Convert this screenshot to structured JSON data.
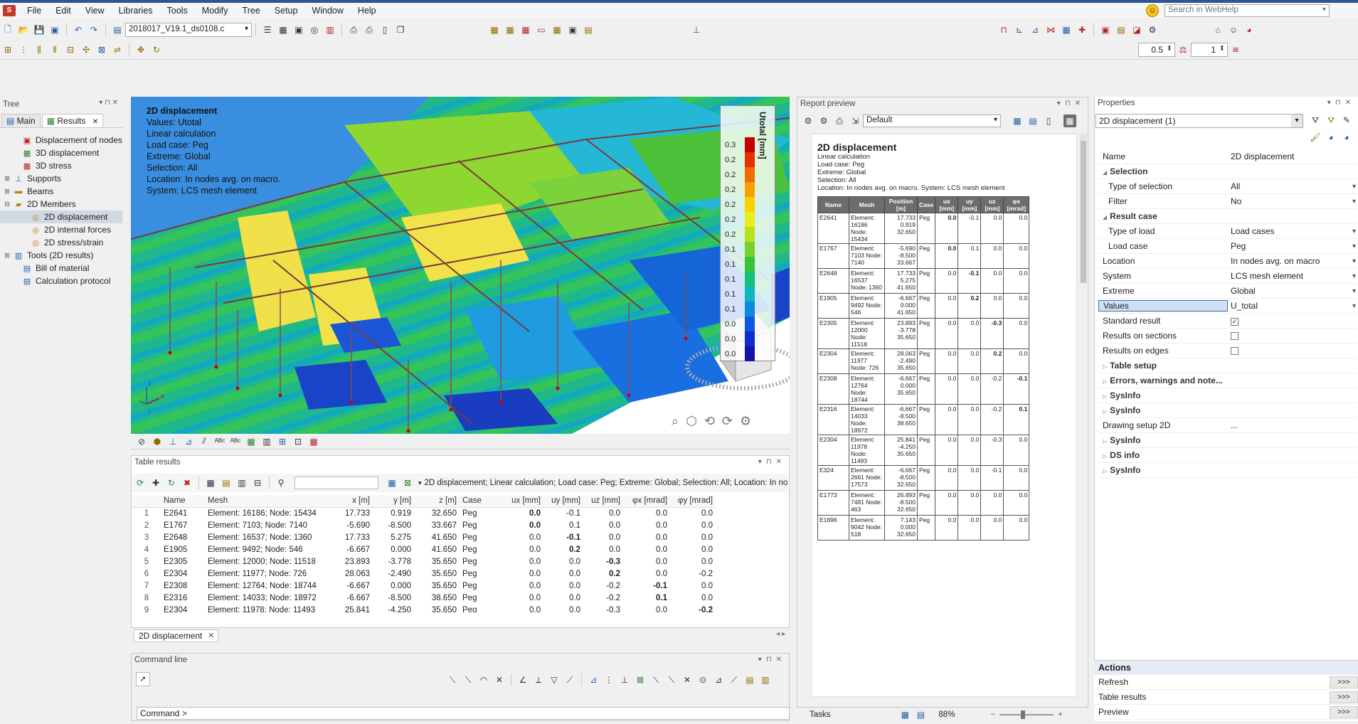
{
  "menu": [
    "File",
    "Edit",
    "View",
    "Libraries",
    "Tools",
    "Modify",
    "Tree",
    "Setup",
    "Window",
    "Help"
  ],
  "search": {
    "placeholder": "Search in WebHelp"
  },
  "toolbar": {
    "file_name": "2018017_V19.1_ds0108.c",
    "spin1": "0.5",
    "spin2": "1"
  },
  "tree": {
    "title": "Tree",
    "tabs": [
      "Main",
      "Results"
    ],
    "items": [
      {
        "label": "Displacement of nodes",
        "icon": "node-displacement-icon"
      },
      {
        "label": "3D displacement",
        "icon": "3d-displacement-icon"
      },
      {
        "label": "3D stress",
        "icon": "3d-stress-icon"
      },
      {
        "label": "Supports",
        "icon": "supports-icon"
      },
      {
        "label": "Beams",
        "icon": "beams-icon"
      },
      {
        "label": "2D Members",
        "icon": "2d-members-icon"
      },
      {
        "label": "2D displacement",
        "icon": "2d-displacement-icon"
      },
      {
        "label": "2D internal forces",
        "icon": "2d-forces-icon"
      },
      {
        "label": "2D stress/strain",
        "icon": "2d-stress-icon"
      },
      {
        "label": "Tools (2D results)",
        "icon": "tools-icon"
      },
      {
        "label": "Bill of material",
        "icon": "bill-icon"
      },
      {
        "label": "Calculation protocol",
        "icon": "protocol-icon"
      }
    ]
  },
  "viewport": {
    "title": "2D displacement",
    "lines": [
      "Values: Utotal",
      "Linear calculation",
      "Load case: Peg",
      "Extreme: Global",
      "Selection: All",
      "Location: In nodes avg. on macro.",
      "System: LCS mesh element"
    ],
    "legend_title": "Utotal [mm]",
    "legend_values": [
      "0.3",
      "0.2",
      "0.2",
      "0.2",
      "0.2",
      "0.2",
      "0.2",
      "0.1",
      "0.1",
      "0.1",
      "0.1",
      "0.1",
      "0.0",
      "0.0",
      "0.0"
    ],
    "legend_colors": [
      "#c40000",
      "#e53000",
      "#f06a00",
      "#f7a000",
      "#f7d300",
      "#e7ee1c",
      "#b8e21c",
      "#78d22a",
      "#38c238",
      "#14bf7a",
      "#0cb8c0",
      "#0c8ae0",
      "#0c58e0",
      "#0c2ed0",
      "#1414a8"
    ]
  },
  "table": {
    "title": "Table results",
    "description": "2D displacement; Linear calculation; Load case: Peg; Extreme: Global; Selection: All; Location: In nodes avg",
    "columns": [
      "",
      "Name",
      "Mesh",
      "x [m]",
      "y [m]",
      "z [m]",
      "Case",
      "ux [mm]",
      "uy [mm]",
      "uz [mm]",
      "φx [mrad]",
      "φy [mrad]"
    ],
    "rows": [
      [
        "1",
        "E2641",
        "Element: 16186; Node: 15434",
        "17.733",
        "0.919",
        "32.650",
        "Peg",
        "0.0",
        "-0.1",
        "0.0",
        "0.0",
        "0.0"
      ],
      [
        "2",
        "E1767",
        "Element: 7103; Node: 7140",
        "-5.690",
        "-8.500",
        "33.667",
        "Peg",
        "0.0",
        "0.1",
        "0.0",
        "0.0",
        "0.0"
      ],
      [
        "3",
        "E2648",
        "Element: 16537; Node: 1360",
        "17.733",
        "5.275",
        "41.650",
        "Peg",
        "0.0",
        "-0.1",
        "0.0",
        "0.0",
        "0.0"
      ],
      [
        "4",
        "E1905",
        "Element: 9492; Node: 546",
        "-6.667",
        "0.000",
        "41.650",
        "Peg",
        "0.0",
        "0.2",
        "0.0",
        "0.0",
        "0.0"
      ],
      [
        "5",
        "E2305",
        "Element: 12000; Node: 11518",
        "23.893",
        "-3.778",
        "35.650",
        "Peg",
        "0.0",
        "0.0",
        "-0.3",
        "0.0",
        "0.0"
      ],
      [
        "6",
        "E2304",
        "Element: 11977; Node: 726",
        "28.063",
        "-2.490",
        "35.650",
        "Peg",
        "0.0",
        "0.0",
        "0.2",
        "0.0",
        "-0.2"
      ],
      [
        "7",
        "E2308",
        "Element: 12764; Node: 18744",
        "-6.667",
        "0.000",
        "35.650",
        "Peg",
        "0.0",
        "0.0",
        "-0.2",
        "-0.1",
        "0.0"
      ],
      [
        "8",
        "E2316",
        "Element: 14033; Node: 18972",
        "-6.667",
        "-8.500",
        "38.650",
        "Peg",
        "0.0",
        "0.0",
        "-0.2",
        "0.1",
        "0.0"
      ],
      [
        "9",
        "E2304",
        "Element: 11978; Node: 11493",
        "25.841",
        "-4.250",
        "35.650",
        "Peg",
        "0.0",
        "0.0",
        "-0.3",
        "0.0",
        "-0.2"
      ]
    ],
    "tab_label": "2D displacement"
  },
  "command": {
    "title": "Command line",
    "prompt": "Command >"
  },
  "report": {
    "title": "Report preview",
    "combo": "Default",
    "page_title": "2D displacement",
    "meta": [
      "Linear calculation",
      "Load case: Peg",
      "Extreme: Global",
      "Selection: All",
      "Location: In nodes avg. on macro. System: LCS mesh element"
    ],
    "columns": [
      "Name",
      "Mesh",
      "Position [m]",
      "Case",
      "ux [mm]",
      "uy [mm]",
      "uz [mm]",
      "φx [mrad]"
    ],
    "rows": [
      [
        "E2641",
        "Element: 16186 Node: 15434",
        "17.733 0.919 32.650",
        "Peg",
        "0.0",
        "-0.1",
        "0.0",
        "0.0"
      ],
      [
        "E1767",
        "Element: 7103 Node: 7140",
        "-5.690 -8.500 33.667",
        "Peg",
        "0.0",
        "0.1",
        "0.0",
        "0.0"
      ],
      [
        "E2648",
        "Element: 16537 Node: 1360",
        "17.733 5.275 41.650",
        "Peg",
        "0.0",
        "-0.1",
        "0.0",
        "0.0"
      ],
      [
        "E1905",
        "Element: 9492 Node: 546",
        "-6.667 0.000 41.650",
        "Peg",
        "0.0",
        "0.2",
        "0.0",
        "0.0"
      ],
      [
        "E2305",
        "Element: 12000 Node: 11518",
        "23.893 -3.778 35.650",
        "Peg",
        "0.0",
        "0.0",
        "-0.3",
        "0.0"
      ],
      [
        "E2304",
        "Element: 11977 Node: 726",
        "28.063 -2.490 35.650",
        "Peg",
        "0.0",
        "0.0",
        "0.2",
        "0.0"
      ],
      [
        "E2308",
        "Element: 12764 Node: 18744",
        "-6.667 0.000 35.650",
        "Peg",
        "0.0",
        "0.0",
        "-0.2",
        "-0.1"
      ],
      [
        "E2316",
        "Element: 14033 Node: 18972",
        "-6.667 -8.500 38.650",
        "Peg",
        "0.0",
        "0.0",
        "-0.2",
        "0.1"
      ],
      [
        "E2304",
        "Element: 11978 Node: 11493",
        "25.841 -4.250 35.650",
        "Peg",
        "0.0",
        "0.0",
        "-0.3",
        "0.0"
      ],
      [
        "E324",
        "Element: 2661 Node: 17573",
        "-6.667 -8.500 32.650",
        "Peg",
        "0.0",
        "0.0",
        "-0.1",
        "0.0"
      ],
      [
        "E1773",
        "Element: 7481 Node: 463",
        "26.893 -8.500 32.650",
        "Peg",
        "0.0",
        "0.0",
        "0.0",
        "0.0"
      ],
      [
        "E1896",
        "Element: 9042 Node: 518",
        "7.143 0.000 32.650",
        "Peg",
        "0.0",
        "0.0",
        "0.0",
        "0.0"
      ]
    ],
    "tasks_label": "Tasks",
    "zoom": "88%"
  },
  "properties": {
    "title": "Properties",
    "combo": "2D displacement (1)",
    "rows": [
      {
        "k": "Name",
        "v": "2D displacement",
        "type": "text"
      },
      {
        "k": "Selection",
        "type": "section"
      },
      {
        "k": "Type of selection",
        "v": "All",
        "type": "dd",
        "ind": true
      },
      {
        "k": "Filter",
        "v": "No",
        "type": "dd",
        "ind": true
      },
      {
        "k": "Result case",
        "type": "section"
      },
      {
        "k": "Type of load",
        "v": "Load cases",
        "type": "dd",
        "ind": true
      },
      {
        "k": "Load case",
        "v": "Peg",
        "type": "dd",
        "ind": true
      },
      {
        "k": "Location",
        "v": "In nodes avg. on macro",
        "type": "dd"
      },
      {
        "k": "System",
        "v": "LCS mesh element",
        "type": "dd"
      },
      {
        "k": "Extreme",
        "v": "Global",
        "type": "dd"
      },
      {
        "k": "Values",
        "v": "U_total",
        "type": "dd",
        "hl": true
      },
      {
        "k": "Standard result",
        "type": "check",
        "checked": true
      },
      {
        "k": "Results on sections",
        "type": "check",
        "checked": false
      },
      {
        "k": "Results on edges",
        "type": "check",
        "checked": false
      },
      {
        "k": "Table setup",
        "type": "csection"
      },
      {
        "k": "Errors, warnings and note...",
        "type": "csection"
      },
      {
        "k": "SysInfo",
        "type": "csection"
      },
      {
        "k": "SysInfo",
        "type": "csection"
      },
      {
        "k": "Drawing setup 2D",
        "v": "...",
        "type": "text"
      },
      {
        "k": "SysInfo",
        "type": "csection"
      },
      {
        "k": "DS info",
        "type": "csection"
      },
      {
        "k": "SysInfo",
        "type": "csection"
      }
    ],
    "actions_title": "Actions",
    "actions": [
      "Refresh",
      "Table results",
      "Preview"
    ],
    "action_btn": ">>>"
  }
}
